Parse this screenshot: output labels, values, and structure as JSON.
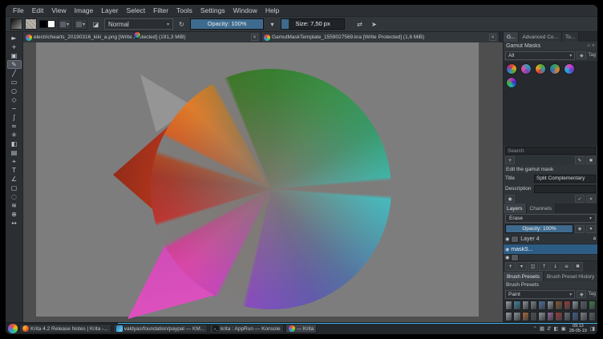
{
  "icons": {
    "dropdown": "▾",
    "close": "×",
    "reload": "↻",
    "eraser": "◪",
    "mirror": "⇄",
    "flow": "➤",
    "tag": "◈",
    "eye": "◉",
    "float": "▫",
    "preview": "◉",
    "save": "✓",
    "cancel": "×",
    "new": "+",
    "edit": "✎",
    "delete": "✖",
    "panel": "◨"
  },
  "menubar": {
    "items": [
      "File",
      "Edit",
      "View",
      "Image",
      "Layer",
      "Select",
      "Filter",
      "Tools",
      "Settings",
      "Window",
      "Help"
    ]
  },
  "toolbar": {
    "blend_mode": "Normal",
    "opacity": "Opacity: 100%",
    "size": "Size: 7,50 px"
  },
  "document_tabs": [
    {
      "label": "electrichearts_20190316_kiki_a.png [Write Protected] (191,3 MiB)"
    },
    {
      "label": "GamutMaskTemplate_1559027569.kra [Write Protected] (1,6 MiB)"
    }
  ],
  "toolbox": {
    "tools": [
      {
        "name": "transform-tool",
        "glyph": "►"
      },
      {
        "name": "move-tool",
        "glyph": "+"
      },
      {
        "name": "crop-tool",
        "glyph": "▣"
      },
      {
        "name": "freehand-brush-tool",
        "glyph": "✎",
        "selected": true
      },
      {
        "name": "line-tool",
        "glyph": "╱"
      },
      {
        "name": "rectangle-tool",
        "glyph": "▭"
      },
      {
        "name": "ellipse-tool",
        "glyph": "○"
      },
      {
        "name": "polygon-tool",
        "glyph": "◇"
      },
      {
        "name": "polyline-tool",
        "glyph": "~"
      },
      {
        "name": "bezier-curve-tool",
        "glyph": "∫"
      },
      {
        "name": "freehand-path-tool",
        "glyph": "≈"
      },
      {
        "name": "multibrush-tool",
        "glyph": "✳"
      },
      {
        "name": "fill-tool",
        "glyph": "◧"
      },
      {
        "name": "gradient-tool",
        "glyph": "▤"
      },
      {
        "name": "color-sampler-tool",
        "glyph": "⌖"
      },
      {
        "name": "text-tool",
        "glyph": "T"
      },
      {
        "name": "assistants-tool",
        "glyph": "∠"
      },
      {
        "name": "rectangular-select-tool",
        "glyph": "▢"
      },
      {
        "name": "elliptical-select-tool",
        "glyph": "◌"
      },
      {
        "name": "freehand-select-tool",
        "glyph": "≋"
      },
      {
        "name": "zoom-tool",
        "glyph": "⊕"
      },
      {
        "name": "pan-tool",
        "glyph": "↔"
      }
    ]
  },
  "right_panel": {
    "docker_tabs": [
      "G...",
      "Advanced Co...",
      "To..."
    ],
    "gamut_masks": {
      "title": "Gamut Masks",
      "filter_value": "All",
      "tag_label": "Tag",
      "search_placeholder": "Search",
      "edit_header": "Edit the gamut mask",
      "title_label": "Title",
      "title_value": "Split Complementary",
      "description_label": "Description",
      "mask_count": 6
    },
    "layers": {
      "tabs": [
        "Layers",
        "Channels"
      ],
      "blend_mode": "Erase",
      "opacity_label": "Opacity: 100%",
      "rows": [
        {
          "name": "Layer 4",
          "thumb": "dark",
          "badges": [
            "a"
          ]
        },
        {
          "name": "maskS...",
          "thumb": "wheel",
          "selected": true,
          "badges": []
        },
        {
          "name": "",
          "thumb": "dark",
          "partial": true,
          "badges": []
        }
      ],
      "toolbar": [
        {
          "name": "add-layer-button",
          "glyph": "+"
        },
        {
          "name": "add-layer-dropdown",
          "glyph": "▾"
        },
        {
          "name": "duplicate-layer-button",
          "glyph": "◫"
        },
        {
          "name": "move-layer-up-button",
          "glyph": "↑"
        },
        {
          "name": "move-layer-down-button",
          "glyph": "↓"
        },
        {
          "name": "layer-properties-button",
          "glyph": "≡"
        },
        {
          "name": "delete-layer-button",
          "glyph": "✖"
        }
      ]
    },
    "brush_dockers": {
      "tabs": [
        "Brush Presets",
        "Brush Preset History"
      ],
      "title": "Brush Presets",
      "filter_value": "Paint",
      "tag_label": "Tag",
      "thumb_colors": [
        "#9aa0a5",
        "#43839e",
        "#8d9296",
        "#7c8184",
        "#4d6f9b",
        "#8f9599",
        "#86562f",
        "#a03c38",
        "#8e9397",
        "#575c60",
        "#3f7a46",
        "#9aa0a5",
        "#8d9296",
        "#b06a32",
        "#4d4f52",
        "#8f9599",
        "#98689a",
        "#a03c38",
        "#6a6e72",
        "#3f5f8a",
        "#7c8184",
        "#575c60"
      ]
    }
  },
  "taskbar": {
    "tasks": [
      {
        "icon": "firefox",
        "label": "Krita 4.2 Release Notes | Krita -..."
      },
      {
        "icon": "kmail",
        "label": "valdyas/foundation/paypal — KM..."
      },
      {
        "icon": "konsole",
        "label": "krita : AppRun — Konsole"
      },
      {
        "icon": "krita",
        "label": "— Krita",
        "active": true
      }
    ],
    "tray": [
      {
        "name": "chevron-up-icon",
        "glyph": "⌃"
      },
      {
        "name": "display-icon",
        "glyph": "▦"
      },
      {
        "name": "network-icon",
        "glyph": "⇵"
      },
      {
        "name": "volume-icon",
        "glyph": "◧"
      },
      {
        "name": "clipboard-icon",
        "glyph": "▣"
      }
    ],
    "clock": {
      "time": "09:13",
      "date": "28-05-19"
    }
  }
}
